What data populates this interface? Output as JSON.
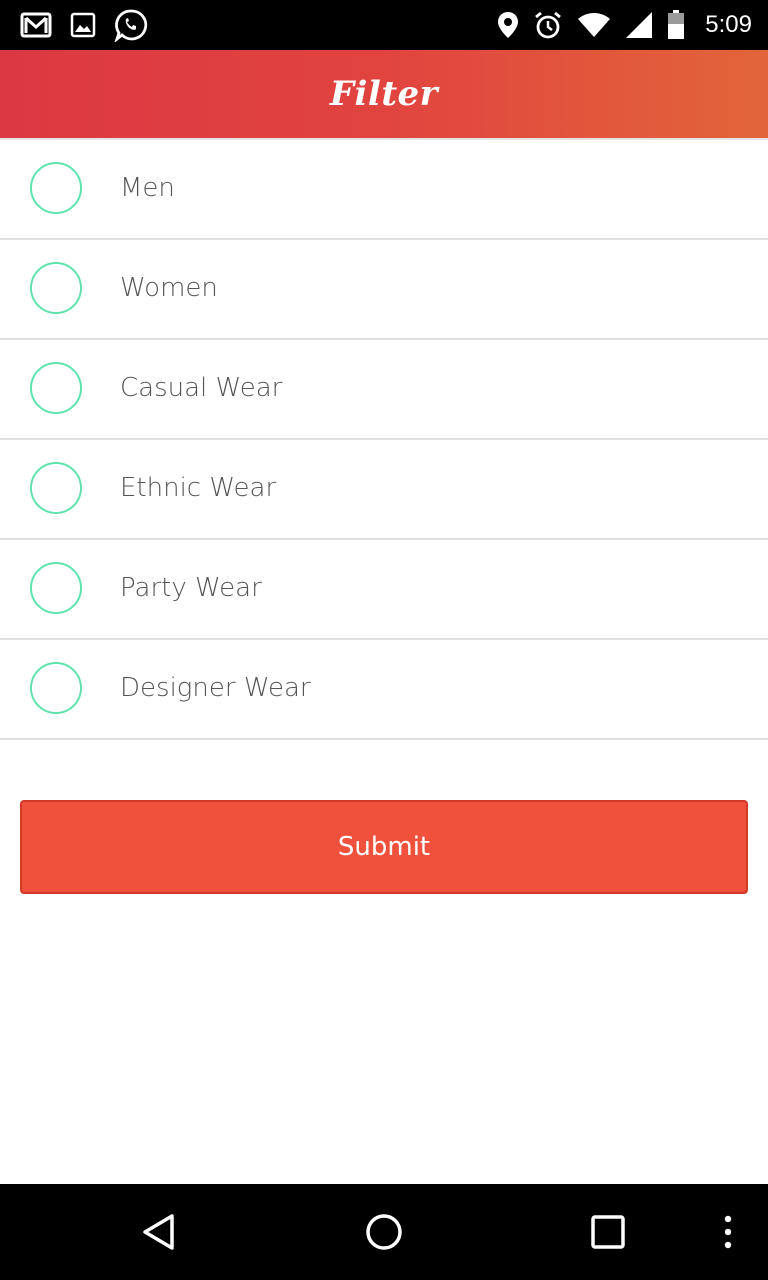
{
  "status_bar": {
    "time": "5:09",
    "left_icons": [
      "gmail-icon",
      "image-icon",
      "whatsapp-icon"
    ],
    "right_icons": [
      "location-icon",
      "alarm-icon",
      "wifi-icon",
      "signal-icon",
      "battery-icon"
    ]
  },
  "app_bar": {
    "title": "Filter"
  },
  "filters": [
    {
      "label": "Men",
      "checked": false
    },
    {
      "label": "Women",
      "checked": false
    },
    {
      "label": "Casual Wear",
      "checked": false
    },
    {
      "label": "Ethnic Wear",
      "checked": false
    },
    {
      "label": "Party Wear",
      "checked": false
    },
    {
      "label": "Designer Wear",
      "checked": false
    }
  ],
  "submit": {
    "label": "Submit"
  },
  "nav_bar": {
    "buttons": [
      "back-icon",
      "home-icon",
      "recents-icon",
      "overflow-menu-icon"
    ]
  },
  "colors": {
    "app_bar_gradient_start": "#dc3843",
    "app_bar_gradient_end": "#e2653a",
    "radio_border": "#5fe3ad",
    "submit_background": "#ef513d",
    "label_text": "#555555"
  }
}
